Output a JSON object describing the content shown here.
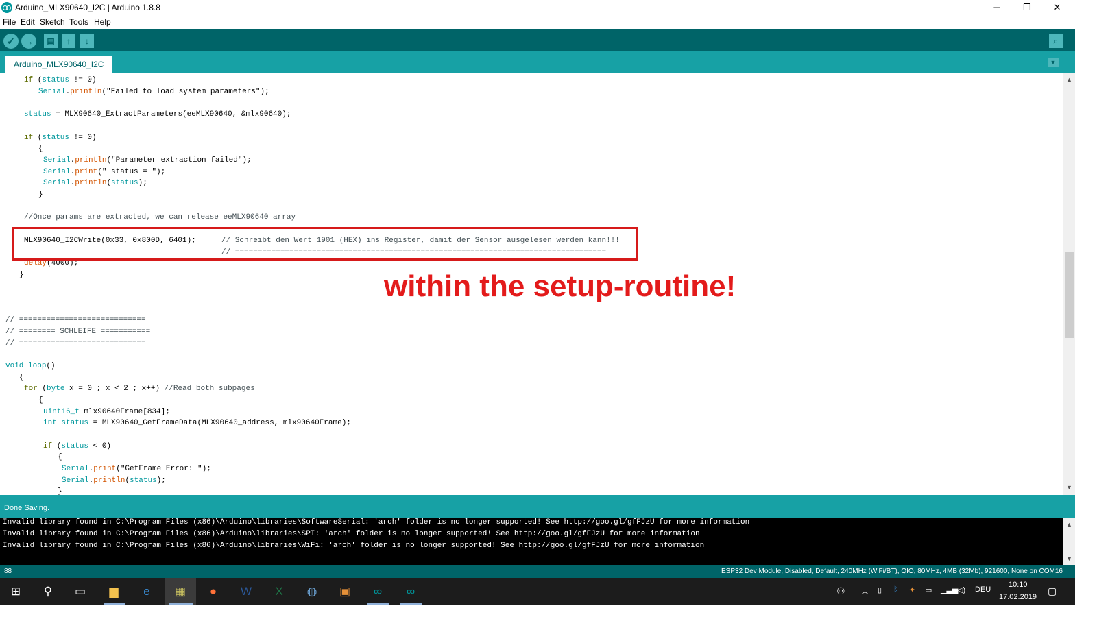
{
  "window": {
    "title": "Arduino_MLX90640_I2C | Arduino 1.8.8",
    "controls": {
      "minimize": "─",
      "restore": "❐",
      "close": "✕"
    }
  },
  "menu": [
    "File",
    "Edit",
    "Sketch",
    "Tools",
    "Help"
  ],
  "toolbar": {
    "verify": "✓",
    "upload": "→",
    "new": "▤",
    "open": "↑",
    "save": "↓",
    "serial_monitor": "⌕"
  },
  "tab": {
    "label": "Arduino_MLX90640_I2C",
    "menu_glyph": "▼"
  },
  "code": {
    "l1a": "if",
    "l1b": " (",
    "l1c": "status",
    "l1d": " != 0)",
    "l2a": "Serial",
    "l2b": ".",
    "l2c": "println",
    "l2d": "(\"Failed to load system parameters\");",
    "l3a": "status",
    "l3b": " = MLX90640_ExtractParameters(eeMLX90640, &mlx90640);",
    "l4a": "if",
    "l4b": " (",
    "l4c": "status",
    "l4d": " != 0)",
    "l5": "{",
    "l6a": "Serial",
    "l6b": ".",
    "l6c": "println",
    "l6d": "(\"Parameter extraction failed\");",
    "l7a": "Serial",
    "l7b": ".",
    "l7c": "print",
    "l7d": "(\" status = \");",
    "l8a": "Serial",
    "l8b": ".",
    "l8c": "println",
    "l8d": "(",
    "l8e": "status",
    "l8f": ");",
    "l9": "}",
    "l10": "//Once params are extracted, we can release eeMLX90640 array",
    "l11a": "MLX90640_I2CWrite(0x33, 0x800D, 6401);",
    "l11b": "// Schreibt den Wert 1901 (HEX) ins Register, damit der Sensor ausgelesen werden kann!!!",
    "l12": "// ==================================================================================",
    "l13a": "delay",
    "l13b": "(4000);",
    "l14": "}",
    "l15": "// ============================",
    "l16": "// ======== SCHLEIFE ===========",
    "l17": "// ============================",
    "l18a": "void",
    "l18b": " ",
    "l18c": "loop",
    "l18d": "()",
    "l19": "{",
    "l20a": "for",
    "l20b": " (",
    "l20c": "byte",
    "l20d": " x = 0 ; x < 2 ; x++) ",
    "l20e": "//Read both subpages",
    "l21": "{",
    "l22a": "uint16_t",
    "l22b": " mlx90640Frame[834];",
    "l23a": "int",
    "l23b": " ",
    "l23c": "status",
    "l23d": " = MLX90640_GetFrameData(MLX90640_address, mlx90640Frame);",
    "l24a": "if",
    "l24b": " (",
    "l24c": "status",
    "l24d": " < 0)",
    "l25": "{",
    "l26a": "Serial",
    "l26b": ".",
    "l26c": "print",
    "l26d": "(\"GetFrame Error: \");",
    "l27a": "Serial",
    "l27b": ".",
    "l27c": "println",
    "l27d": "(",
    "l27e": "status",
    "l27f": ");",
    "l28": "}"
  },
  "annotation": "within the setup-routine!",
  "status": "Done Saving.",
  "console": [
    "Invalid library found in C:\\Program Files (x86)\\Arduino\\libraries\\SoftwareSerial: 'arch' folder is no longer supported! See http://goo.gl/gfFJzU for more information",
    "Invalid library found in C:\\Program Files (x86)\\Arduino\\libraries\\SPI: 'arch' folder is no longer supported! See http://goo.gl/gfFJzU for more information",
    "Invalid library found in C:\\Program Files (x86)\\Arduino\\libraries\\WiFi: 'arch' folder is no longer supported! See http://goo.gl/gfFJzU for more information"
  ],
  "footer": {
    "line_number": "88",
    "board": "ESP32 Dev Module, Disabled, Default, 240MHz (WiFi/BT), QIO, 80MHz, 4MB (32Mb), 921600, None on COM16"
  },
  "taskbar": {
    "language": "DEU",
    "time": "10:10",
    "date": "17.02.2019"
  },
  "colors": {
    "teal_dark": "#006468",
    "teal": "#17a1a5",
    "highlight": "#d61a1a"
  }
}
